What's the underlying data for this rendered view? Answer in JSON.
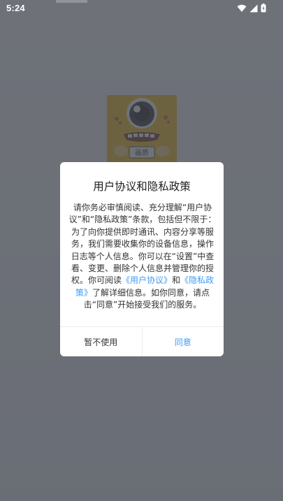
{
  "status_bar": {
    "time": "5:24"
  },
  "splash": {
    "logo_text": "画质"
  },
  "dialog": {
    "title": "用户协议和隐私政策",
    "body": {
      "part1": "请你务必审慎阅读、充分理解“用户协议”和“隐私政策”条款，包括但不限于：为了向你提供即时通讯、内容分享等服务，我们需要收集你的设备信息，操作日志等个人信息。你可以在“设置”中查看、变更、删除个人信息并管理你的授权。你可阅读",
      "link_user_agreement": "《用户协议》",
      "and": "和",
      "link_privacy_policy": "《隐私政策》",
      "part2": "了解详细信息。如你同意，请点击“同意”开始接受我们的服务。"
    },
    "buttons": {
      "decline": "暂不使用",
      "agree": "同意"
    }
  },
  "colors": {
    "link": "#3f9cf2",
    "logo_bg": "#f5b800",
    "scrim": "#464a52"
  },
  "icons": [
    "wifi-icon",
    "signal-icon",
    "battery-icon"
  ]
}
